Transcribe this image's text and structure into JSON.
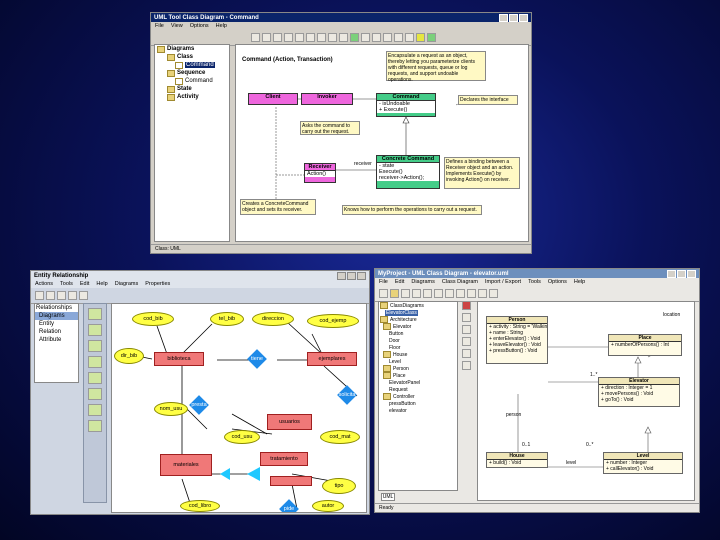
{
  "win1": {
    "title": "UML Tool Class Diagram - Command",
    "menu": [
      "File",
      "View",
      "Options",
      "Help"
    ],
    "tree": [
      {
        "label": "Diagrams",
        "indent": 0
      },
      {
        "label": "Class",
        "indent": 1
      },
      {
        "label": "Command",
        "indent": 2
      },
      {
        "label": "Sequence",
        "indent": 1
      },
      {
        "label": "Command",
        "indent": 2
      },
      {
        "label": "State",
        "indent": 1
      },
      {
        "label": "Activity",
        "indent": 1
      }
    ],
    "diagram_title": "Command (Action, Transaction)",
    "notes": {
      "intent": "Encapsulate a request as an object, thereby letting you parameterize clients with different requests, queue or log requests, and support undoable operations.",
      "declares": "Declares the interface",
      "asks": "Asks the command to carry out the request.",
      "defines": "Defines a binding between a Receiver object and an action. Implements Execute() by invoking Action() on receiver.",
      "creates": "Creates a ConcreteCommand object and sets its receiver.",
      "knows": "Knows how to perform the operations to carry out a request."
    },
    "classes": {
      "client": "Client",
      "invoker": "Invoker",
      "command": "Command",
      "command_attr": "- isUndoable",
      "command_op": "+ Execute()",
      "receiver": "Receiver",
      "receiver_op": "Action()",
      "concrete": "Concrete Command",
      "concrete_attr": "- state",
      "concrete_op1": "Execute()",
      "concrete_op2": "receiver->Action();",
      "receiver_role": "receiver"
    },
    "status": "Class: UML"
  },
  "win2": {
    "title": "Entity Relationship",
    "menu": [
      "Actions",
      "Tools",
      "Edit",
      "Help",
      "Diagrams",
      "Properties"
    ],
    "tree": [
      "Relationships",
      "Diagrams",
      "Entity",
      "Relation",
      "Attribute"
    ],
    "entities": [
      "biblioteca",
      "ejemplares",
      "usuarios",
      "materiales",
      "tratamiento"
    ],
    "attributes": [
      "cod_bib",
      "tel_bib",
      "direccion",
      "cod_ejemp",
      "dir_bib",
      "nom_usu",
      "cod_usu",
      "cod_mat",
      "tipo",
      "cod_libro",
      "autor"
    ],
    "relations": [
      "tiene",
      "presta",
      "solicita",
      "pide"
    ]
  },
  "win3": {
    "title": "MyProject - UML Class Diagram - elevator.uml",
    "menu": [
      "File",
      "Edit",
      "Diagrams",
      "Class Diagram",
      "Import / Export",
      "Tools",
      "Options",
      "Help"
    ],
    "tree": [
      "ClassDiagrams",
      "ElevatorClass",
      "Architecture",
      "Elevator",
      "Button",
      "Door",
      "Floor",
      "House",
      "Level",
      "Person",
      "Place",
      "ElevatorPanel",
      "Request",
      "Controller",
      "pressButton",
      "elevator"
    ],
    "classes": {
      "person": {
        "name": "Person",
        "rows": [
          "+ activity : String = 'Walking'",
          "+ name : String",
          "+ enterElevator() : Void",
          "+ leaveElevator() : Void",
          "+ pressButton() : Void"
        ]
      },
      "place": {
        "name": "Place",
        "rows": [
          "+ numberOfPersons() : Int"
        ]
      },
      "elevator": {
        "name": "Elevator",
        "rows": [
          "+ direction : Integer = 1",
          "+ movePersons() : Void",
          "+ goTo() : Void"
        ]
      },
      "house": {
        "name": "House",
        "rows": [
          "+ build() : Void"
        ]
      },
      "level": {
        "name": "Level",
        "rows": [
          "+ number : Integer",
          "+ callElevator() : Void"
        ]
      }
    },
    "labels": {
      "location": "location",
      "person_role": "person",
      "level_role": "level",
      "mult1": "0..1",
      "mult2": "0..*",
      "mult3": "1..*"
    },
    "tab": "UML",
    "status": "Ready"
  },
  "colors": {
    "titlebar_blue": "#0a246a",
    "er_entity": "#f07878",
    "er_attribute": "#ffff44",
    "er_relation": "#1e8ae8",
    "uml_pink": "#ee66dd",
    "uml_green": "#44cc88"
  }
}
